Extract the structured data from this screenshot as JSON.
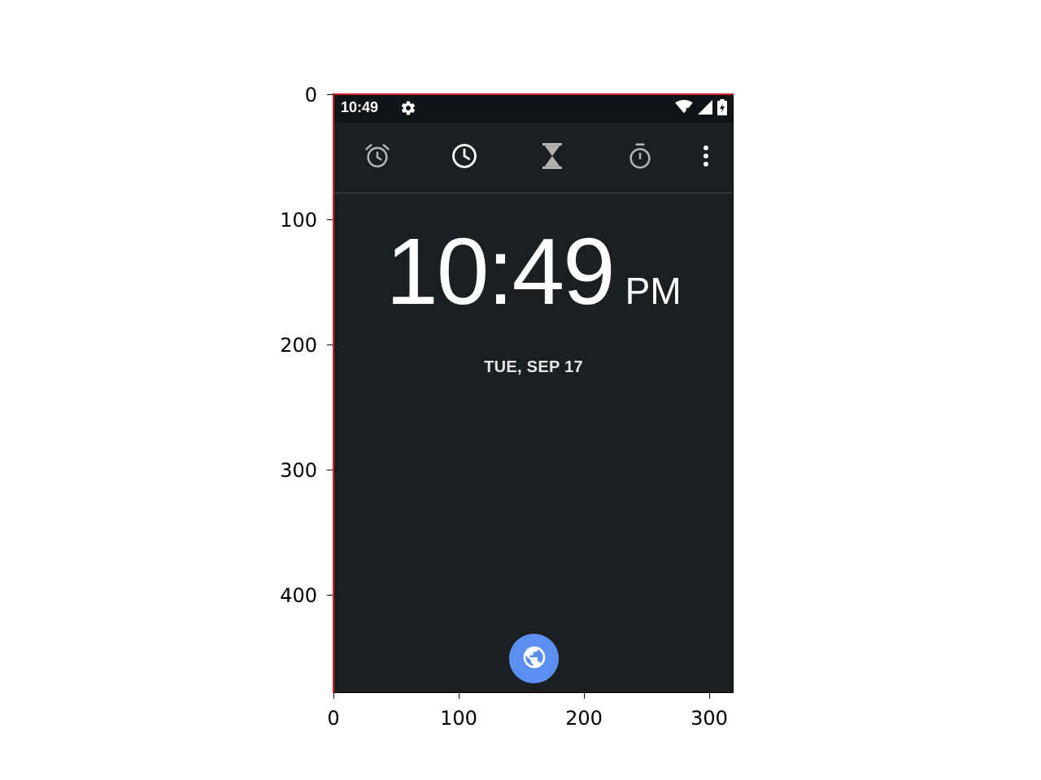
{
  "status_bar": {
    "time": "10:49",
    "icons": [
      "gear-icon",
      "wifi-icon",
      "signal-icon",
      "battery-icon"
    ]
  },
  "toolbar": {
    "tabs": [
      {
        "icon": "alarm-icon"
      },
      {
        "icon": "clock-icon",
        "selected": true
      },
      {
        "icon": "timer-hourglass-icon"
      },
      {
        "icon": "stopwatch-icon"
      },
      {
        "icon": "more-vert-icon"
      }
    ]
  },
  "clock": {
    "time": "10:49",
    "ampm": "PM",
    "date": "TUE, SEP 17"
  },
  "fab": {
    "icon": "globe-icon"
  },
  "axes": {
    "y_ticks": [
      "0",
      "100",
      "200",
      "300",
      "400"
    ],
    "x_ticks": [
      "0",
      "100",
      "200",
      "300"
    ]
  },
  "colors": {
    "background": "#1b1f22",
    "status_bar": "#111416",
    "fab": "#5b8ff0",
    "border_accent": "#cc1f1f"
  }
}
